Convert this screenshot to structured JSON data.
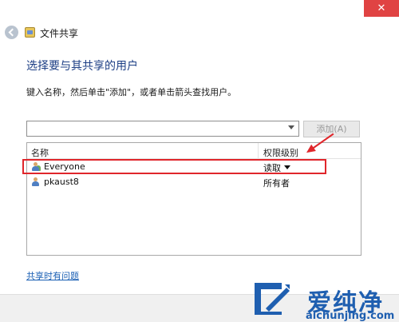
{
  "window": {
    "close_glyph": "✕",
    "title": "文件共享"
  },
  "main": {
    "heading": "选择要与其共享的用户",
    "instruction": "键入名称，然后单击\"添加\"，或者单击箭头查找用户。",
    "user_input_value": "",
    "add_button_label": "添加(A)"
  },
  "list": {
    "columns": [
      "名称",
      "权限级别"
    ],
    "rows": [
      {
        "name": "Everyone",
        "permission": "读取",
        "icon": "group-icon",
        "has_dropdown": true
      },
      {
        "name": "pkaust8",
        "permission": "所有者",
        "icon": "user-icon",
        "has_dropdown": false
      }
    ]
  },
  "help_link": "共享时有问题",
  "watermark": {
    "text": "爱纯净",
    "url": "aichunjing.com"
  },
  "colors": {
    "accent_heading": "#1d3f85",
    "annotation_red": "#e0262b",
    "close_red": "#e04343",
    "link_blue": "#1a5fb4",
    "watermark_blue": "#1f5fb0"
  }
}
